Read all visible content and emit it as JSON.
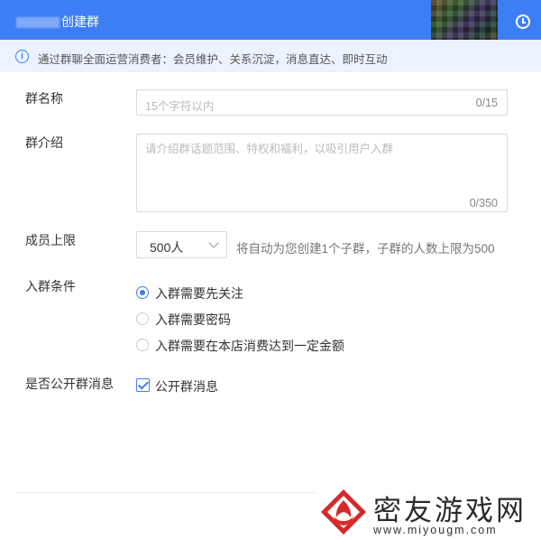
{
  "header": {
    "title_suffix": "创建群"
  },
  "notice": {
    "text": "通过群聊全面运营消费者：会员维护、关系沉淀，消息直达、即时互动"
  },
  "form": {
    "name": {
      "label": "群名称",
      "placeholder": "15个字符以内",
      "count": "0/15"
    },
    "intro": {
      "label": "群介绍",
      "placeholder": "请介绍群话题范围、特权和福利，以吸引用户入群",
      "count": "0/350"
    },
    "limit": {
      "label": "成员上限",
      "value": "500人",
      "hint": "将自动为您创建1个子群，子群的人数上限为500"
    },
    "condition": {
      "label": "入群条件",
      "options": [
        "入群需要先关注",
        "入群需要密码",
        "入群需要在本店消费达到一定金额"
      ],
      "selected": 0
    },
    "public": {
      "label": "是否公开群消息",
      "checkbox_label": "公开群消息",
      "checked": true
    }
  },
  "watermark": {
    "name": "密友游戏网",
    "url": "www.miyougm.com"
  },
  "colors": {
    "accent": "#3d7ef5",
    "notice_bg": "#ecf3fe",
    "watermark_red": "#d42a2a"
  }
}
